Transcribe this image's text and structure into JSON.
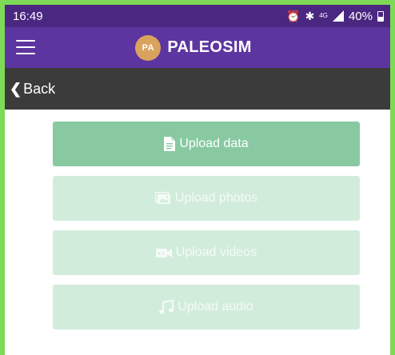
{
  "status_bar": {
    "time": "16:49",
    "network": "4G",
    "battery": "40%"
  },
  "app_bar": {
    "logo_text": "PA",
    "title": "PALEOSIM"
  },
  "back_bar": {
    "label": "Back"
  },
  "actions": [
    {
      "label": "Upload data",
      "icon": "document-icon",
      "state": "enabled"
    },
    {
      "label": "Upload photos",
      "icon": "photos-icon",
      "state": "disabled"
    },
    {
      "label": "Upload videos",
      "icon": "video-camera-icon",
      "state": "disabled"
    },
    {
      "label": "Upload audio",
      "icon": "music-note-icon",
      "state": "disabled"
    }
  ],
  "colors": {
    "status_bar": "#4a2780",
    "app_bar": "#5d35a0",
    "back_bar": "#3b3b3b",
    "button_active": "#88c9a2",
    "button_disabled": "#d2ecdc",
    "logo": "#d9a35e"
  }
}
